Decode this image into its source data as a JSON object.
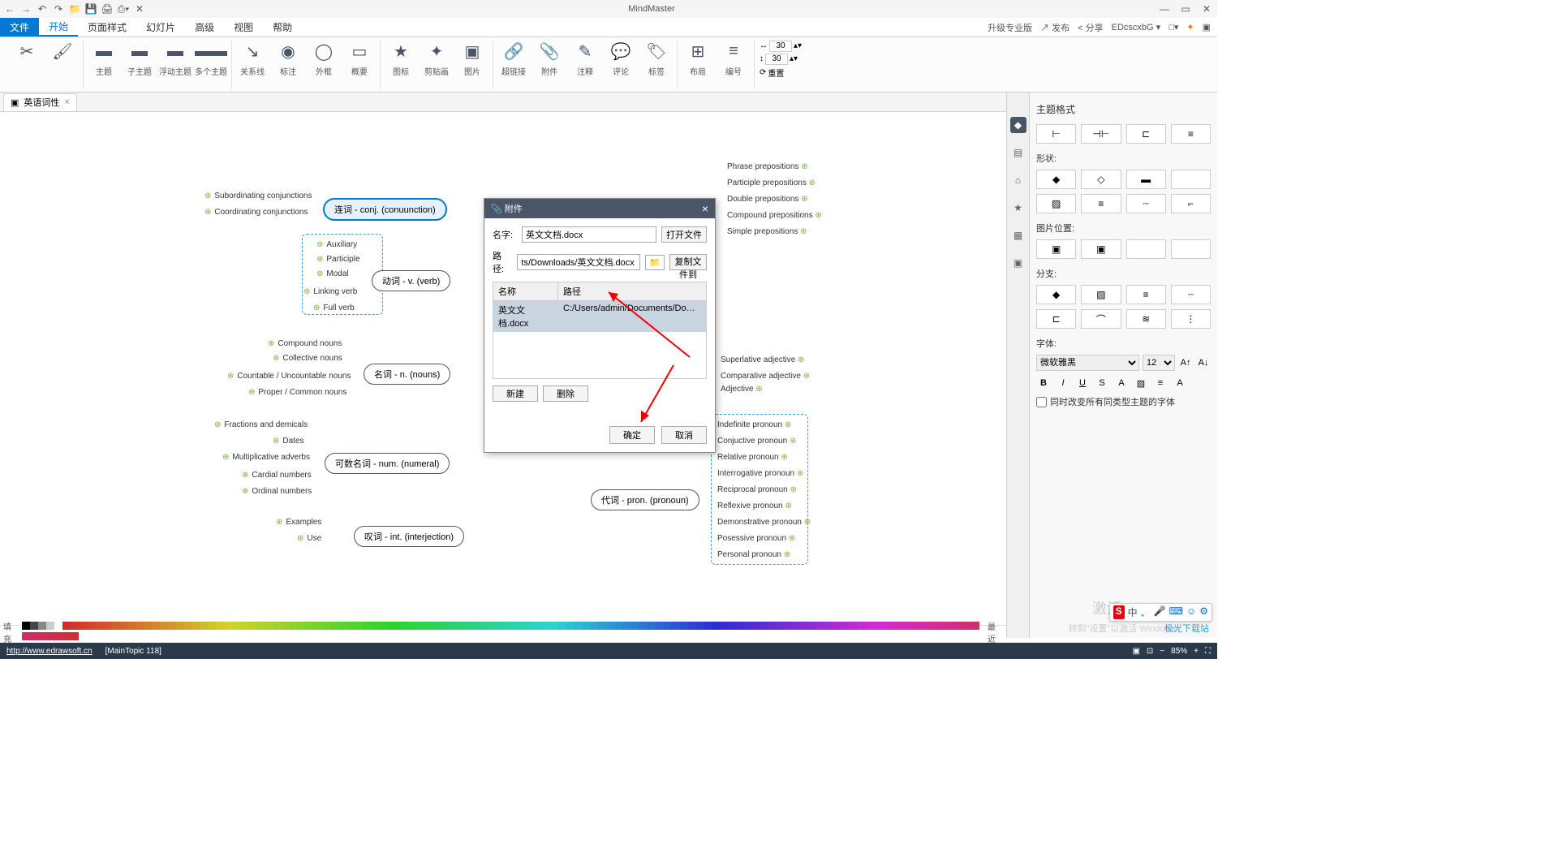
{
  "app_title": "MindMaster",
  "qat": [
    "←",
    "→",
    "↶",
    "↷",
    "📁",
    "💾",
    "🖨",
    "⎙▾",
    "✕"
  ],
  "menu": {
    "file": "文件",
    "items": [
      "开始",
      "页面样式",
      "幻灯片",
      "高级",
      "视图",
      "帮助"
    ],
    "active": "开始",
    "right": {
      "upgrade": "升级专业版",
      "publish": "↗ 发布",
      "share": "< 分享",
      "user": "EDcscxbG ▾"
    }
  },
  "ribbon": {
    "groups": [
      {
        "items": [
          {
            "icon": "✂",
            "label": ""
          },
          {
            "icon": "🖌",
            "label": ""
          }
        ]
      },
      {
        "items": [
          {
            "icon": "▭",
            "label": "主题"
          },
          {
            "icon": "▭",
            "label": "子主题"
          },
          {
            "icon": "▭",
            "label": "浮动主题"
          },
          {
            "icon": "▭▭",
            "label": "多个主题"
          }
        ]
      },
      {
        "items": [
          {
            "icon": "↘",
            "label": "关系线"
          },
          {
            "icon": "◉",
            "label": "标注"
          },
          {
            "icon": "◯",
            "label": "外框"
          },
          {
            "icon": "▭",
            "label": "概要"
          }
        ]
      },
      {
        "items": [
          {
            "icon": "★",
            "label": "图标"
          },
          {
            "icon": "✦",
            "label": "剪贴画"
          },
          {
            "icon": "▣",
            "label": "图片"
          }
        ]
      },
      {
        "items": [
          {
            "icon": "🔗",
            "label": "超链接"
          },
          {
            "icon": "📎",
            "label": "附件"
          },
          {
            "icon": "✎",
            "label": "注释"
          },
          {
            "icon": "💬",
            "label": "评论"
          },
          {
            "icon": "🏷",
            "label": "标签"
          }
        ]
      },
      {
        "items": [
          {
            "icon": "⊞",
            "label": "布局"
          },
          {
            "icon": "≡",
            "label": "编号"
          }
        ]
      }
    ],
    "spacing": {
      "w": "30",
      "h": "30",
      "reset": "重置"
    }
  },
  "doc_tab": {
    "name": "英语词性",
    "close": "×"
  },
  "mindmap": {
    "n1": {
      "text": "连词 - conj. (conuunction)",
      "subs_l": [
        "Subordinating conjunctions",
        "Coordinating conjunctions"
      ]
    },
    "n2": {
      "text": "动词 - v. (verb)",
      "subs_l": [
        "Auxiliary",
        "Participle",
        "Modal",
        "Linking verb",
        "Full  verb"
      ]
    },
    "n3": {
      "text": "名词 - n. (nouns)",
      "subs_l": [
        "Compound nouns",
        "Collective nouns",
        "Countable / Uncountable nouns",
        "Proper / Common nouns"
      ]
    },
    "n4": {
      "text": "可数名词 - num. (numeral)",
      "subs_l": [
        "Fractions and demicals",
        "Dates",
        "Multiplicative adverbs",
        "Cardial numbers",
        "Ordinal numbers"
      ]
    },
    "n5": {
      "text": "叹词 - int. (interjection)",
      "subs_l": [
        "Examples",
        "Use"
      ]
    },
    "n6": {
      "text": "代词 - pron. (pronoun)"
    },
    "r1": [
      "Phrase prepositions",
      "Participle prepositions",
      "Double prepositions",
      "Compound prepositions",
      "Simple prepositions"
    ],
    "r2": [
      "Superlative adjective",
      "Comparative adjective",
      "Adjective"
    ],
    "r3": [
      "Indefinite pronoun",
      "Conjuctive pronoun",
      "Relative pronoun",
      "Interrogative pronoun",
      "Reciprocal pronoun",
      "Reflexive pronoun",
      "Demonstrative pronoun",
      "Posessive pronoun",
      "Personal pronoun"
    ]
  },
  "dialog": {
    "title": "附件",
    "icon": "📎",
    "name_label": "名字:",
    "name_value": "英文文档.docx",
    "open_btn": "打开文件",
    "path_label": "路径:",
    "path_value": "ts/Downloads/英文文档.docx",
    "copy_btn": "复制文件到",
    "th_name": "名称",
    "th_path": "路径",
    "row_name": "英文文档.docx",
    "row_path": "C:/Users/admin/Documents/Downl...",
    "new_btn": "新建",
    "del_btn": "删除",
    "ok_btn": "确定",
    "cancel_btn": "取消"
  },
  "sidebar": {
    "title": "主题格式",
    "sections": {
      "shape": "形状:",
      "imgpos": "图片位置:",
      "branch": "分支:",
      "font": "字体:"
    },
    "font_name": "微软雅黑",
    "font_size": "12",
    "checkbox": "同时改变所有同类型主题的字体"
  },
  "palette": {
    "label": "填充",
    "recent": "最近"
  },
  "status": {
    "url": "http://www.edrawsoft.cn",
    "topic": "[MainTopic 118]",
    "zoom": "85%"
  },
  "watermark": {
    "l1": "激活 Windows",
    "l2": "转到\"设置\"以激活 Windows。",
    "logo": "极光下载站"
  },
  "ime": [
    "中",
    "、",
    "🎤",
    "⌨",
    "☺",
    "⚙"
  ]
}
